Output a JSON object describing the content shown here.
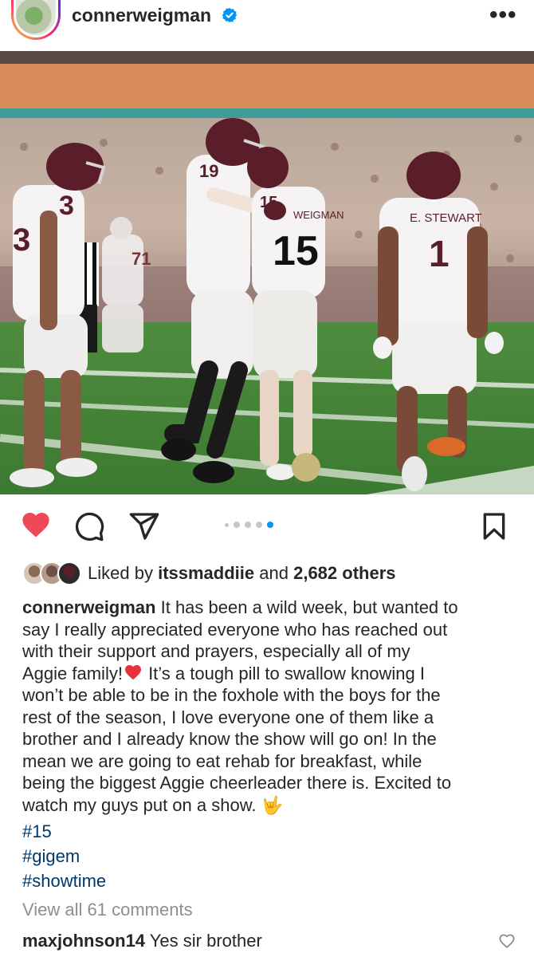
{
  "post": {
    "username": "connerweigman",
    "more_label": "•••",
    "verified_icon": "verified-badge-icon"
  },
  "photo": {
    "description_icon": "football-celebration-photo",
    "jersey_numbers": [
      "3",
      "19",
      "15",
      "1",
      "71"
    ],
    "jersey_names": [
      "E. STEWART",
      "WEIGMAN"
    ]
  },
  "actions": {
    "liked": true,
    "carousel_count": 5,
    "carousel_active": 4,
    "colors": {
      "heart": "#ed4956",
      "active_dot": "#0095f6"
    }
  },
  "likes": {
    "prefix": "Liked by",
    "liker": "itssmaddiie",
    "conjunction": "and",
    "others": "2,682 others"
  },
  "caption": {
    "username": "connerweigman",
    "lines": [
      "It has been a wild week, but wanted to",
      "say I really appreciated everyone who has reached out",
      "with their support and prayers, especially all of my",
      "Aggie family!",
      " It’s a tough pill to swallow knowing I",
      "won’t be able to be in the foxhole with the boys for the",
      "rest of the season, I love everyone one of them like a",
      "brother and I already know the show will go on! In the",
      "mean we are going to eat rehab for breakfast, while",
      "being the biggest Aggie cheerleader there is. Excited to",
      "watch my guys put on a show.",
      "🤟"
    ],
    "hashtags": [
      "#15",
      "#gigem",
      "#showtime"
    ]
  },
  "comments": {
    "view_all": "View all 61 comments",
    "first": {
      "username": "maxjohnson14",
      "text": "Yes sir brother"
    }
  }
}
